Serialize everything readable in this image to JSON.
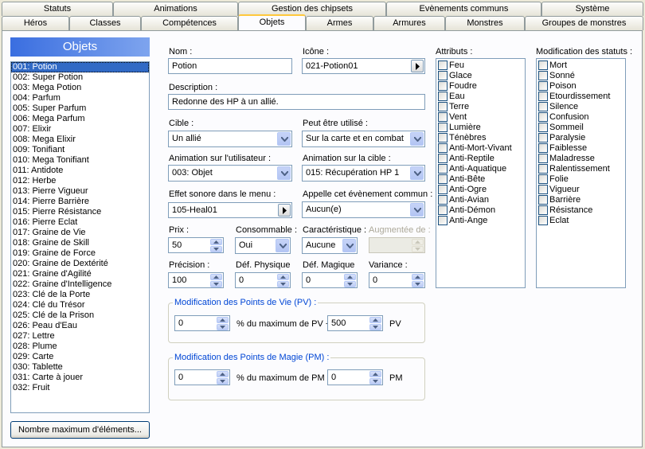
{
  "tabs_row1": [
    "Statuts",
    "Animations",
    "Gestion des chipsets",
    "Evènements communs",
    "Système"
  ],
  "tabs_row2": [
    "Héros",
    "Classes",
    "Compétences",
    "Objets",
    "Armes",
    "Armures",
    "Monstres",
    "Groupes de monstres"
  ],
  "active_tab": "Objets",
  "left": {
    "title": "Objets",
    "items": [
      "001: Potion",
      "002: Super Potion",
      "003: Mega Potion",
      "004: Parfum",
      "005: Super Parfum",
      "006: Mega Parfum",
      "007: Elixir",
      "008: Mega Elixir",
      "009: Tonifiant",
      "010: Mega Tonifiant",
      "011: Antidote",
      "012: Herbe",
      "013: Pierre Vigueur",
      "014: Pierre Barrière",
      "015: Pierre Résistance",
      "016: Pierre Eclat",
      "017: Graine de Vie",
      "018: Graine de Skill",
      "019: Graine de Force",
      "020: Graine de Dextérité",
      "021: Graine d'Agilité",
      "022: Graine d'Intelligence",
      "023: Clé de la Porte",
      "024: Clé du Trésor",
      "025: Clé de la Prison",
      "026: Peau d'Eau",
      "027: Lettre",
      "028: Plume",
      "029: Carte",
      "030: Tablette",
      "031: Carte à jouer",
      "032: Fruit"
    ],
    "selected_index": 0,
    "max_button": "Nombre maximum d'éléments..."
  },
  "form": {
    "nom_label": "Nom :",
    "nom_value": "Potion",
    "icone_label": "Icône :",
    "icone_value": "021-Potion01",
    "desc_label": "Description :",
    "desc_value": "Redonne des HP à un allié.",
    "cible_label": "Cible :",
    "cible_value": "Un allié",
    "usage_label": "Peut être utilisé :",
    "usage_value": "Sur la carte et en combat",
    "anim_user_label": "Animation sur l'utilisateur :",
    "anim_user_value": "003: Objet",
    "anim_target_label": "Animation sur la cible :",
    "anim_target_value": "015: Récupération HP 1",
    "sound_label": "Effet sonore dans le menu :",
    "sound_value": "105-Heal01",
    "event_label": "Appelle cet évènement commun :",
    "event_value": "Aucun(e)",
    "prix_label": "Prix :",
    "prix_value": "50",
    "conso_label": "Consommable :",
    "conso_value": "Oui",
    "carac_label": "Caractéristique :",
    "carac_value": "Aucune",
    "augm_label": "Augmentée de :",
    "augm_value": "",
    "precision_label": "Précision :",
    "precision_value": "100",
    "defp_label": "Déf. Physique",
    "defp_value": "0",
    "defm_label": "Déf. Magique",
    "defm_value": "0",
    "variance_label": "Variance :",
    "variance_value": "0",
    "pv_group": "Modification des Points de Vie (PV) :",
    "pv_percent": "0",
    "pv_mid": "% du maximum de PV +",
    "pv_flat": "500",
    "pv_unit": "PV",
    "pm_group": "Modification des Points de Magie (PM) :",
    "pm_percent": "0",
    "pm_mid": "% du maximum de PM +",
    "pm_flat": "0",
    "pm_unit": "PM"
  },
  "attributes": {
    "label": "Attributs :",
    "items": [
      "Feu",
      "Glace",
      "Foudre",
      "Eau",
      "Terre",
      "Vent",
      "Lumière",
      "Ténèbres",
      "Anti-Mort-Vivant",
      "Anti-Reptile",
      "Anti-Aquatique",
      "Anti-Bête",
      "Anti-Ogre",
      "Anti-Avian",
      "Anti-Démon",
      "Anti-Ange"
    ]
  },
  "states": {
    "label": "Modification des statuts :",
    "items": [
      "Mort",
      "Sonné",
      "Poison",
      "Etourdissement",
      "Silence",
      "Confusion",
      "Sommeil",
      "Paralysie",
      "Faiblesse",
      "Maladresse",
      "Ralentissement",
      "Folie",
      "Vigueur",
      "Barrière",
      "Résistance",
      "Eclat"
    ]
  }
}
